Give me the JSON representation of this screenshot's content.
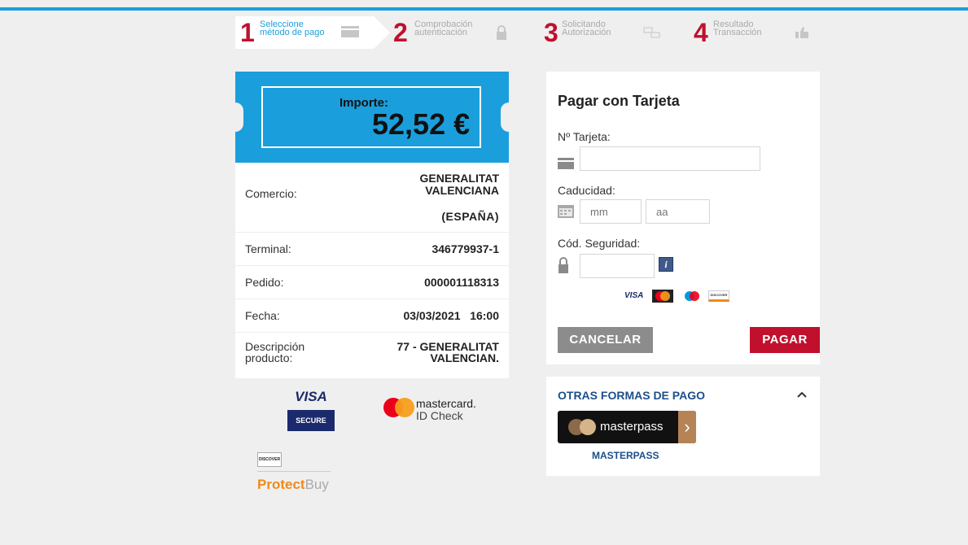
{
  "steps": [
    {
      "num": "1",
      "line1": "Seleccione",
      "line2": "método de pago"
    },
    {
      "num": "2",
      "line1": "Comprobación",
      "line2": "autenticación"
    },
    {
      "num": "3",
      "line1": "Solicitando",
      "line2": "Autorización"
    },
    {
      "num": "4",
      "line1": "Resultado",
      "line2": "Transacción"
    }
  ],
  "ticket": {
    "amount_label": "Importe:",
    "amount_value": "52,52 €",
    "rows": [
      {
        "label": "Comercio:",
        "value_line1": "GENERALITAT",
        "value_line2": "VALENCIANA",
        "value_line3": "(ESPAÑA)"
      },
      {
        "label": "Terminal:",
        "value": "346779937-1"
      },
      {
        "label": "Pedido:",
        "value": "000001118313"
      },
      {
        "label": "Fecha:",
        "value": "03/03/2021   16:00"
      },
      {
        "label_line1": "Descripción",
        "label_line2": "producto:",
        "value_line1": "77 - GENERALITAT",
        "value_line2": "VALENCIAN."
      }
    ]
  },
  "logos": {
    "visa": "VISA",
    "visa_secure": "SECURE",
    "mastercard_line1": "mastercard.",
    "mastercard_line2": "ID Check",
    "discover": "DISCOVER",
    "protect": "Protect",
    "buy": "Buy"
  },
  "card": {
    "title": "Pagar con Tarjeta",
    "card_number_label": "Nº Tarjeta:",
    "expiry_label": "Caducidad:",
    "month_placeholder": "mm",
    "year_placeholder": "aa",
    "cvv_label": "Cód. Seguridad:",
    "cancel": "CANCELAR",
    "pay": "PAGAR",
    "brand_visa": "VISA",
    "brand_discover": "DISCOVER"
  },
  "other": {
    "title": "OTRAS FORMAS DE PAGO",
    "masterpass_button": "masterpass",
    "masterpass_label": "MASTERPASS"
  },
  "colors": {
    "accent": "#1a9fdc",
    "red": "#c0102e",
    "navy": "#1d4f8b"
  }
}
